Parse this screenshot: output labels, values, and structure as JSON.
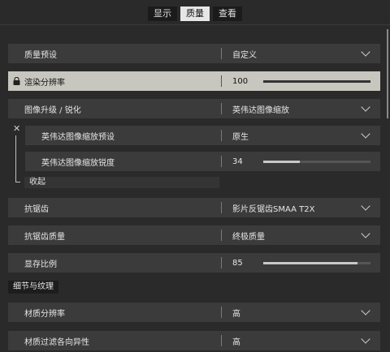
{
  "tabs": [
    {
      "label": "显示",
      "active": false
    },
    {
      "label": "质量",
      "active": true
    },
    {
      "label": "查看",
      "active": false
    }
  ],
  "rows": {
    "quality_preset": {
      "label": "质量预设",
      "value": "自定义"
    },
    "render_resolution": {
      "label": "渲染分辨率",
      "value": "100",
      "fraction": 1.0
    },
    "upscaling": {
      "label": "图像升级 / 锐化",
      "value": "英伟达图像缩放"
    },
    "nis_preset": {
      "label": "英伟达图像缩放预设",
      "value": "原生"
    },
    "nis_sharpness": {
      "label": "英伟达图像缩放锐度",
      "value": "34",
      "fraction": 0.34
    },
    "collapse": {
      "label": "收起"
    },
    "antialiasing": {
      "label": "抗锯齿",
      "value": "影片反锯齿SMAA T2X"
    },
    "aa_quality": {
      "label": "抗锯齿质量",
      "value": "终极质量"
    },
    "vram_scale": {
      "label": "显存比例",
      "value": "85",
      "fraction": 0.88
    }
  },
  "section": {
    "title": "细节与纹理"
  },
  "detail_rows": {
    "texture_resolution": {
      "label": "材质分辨率",
      "value": "高"
    },
    "texture_filtering": {
      "label": "材质过滤各向异性",
      "value": "高"
    }
  },
  "icons": {
    "lock": "lock-icon",
    "chevron": "chevron-down-icon",
    "close": "close-icon"
  }
}
